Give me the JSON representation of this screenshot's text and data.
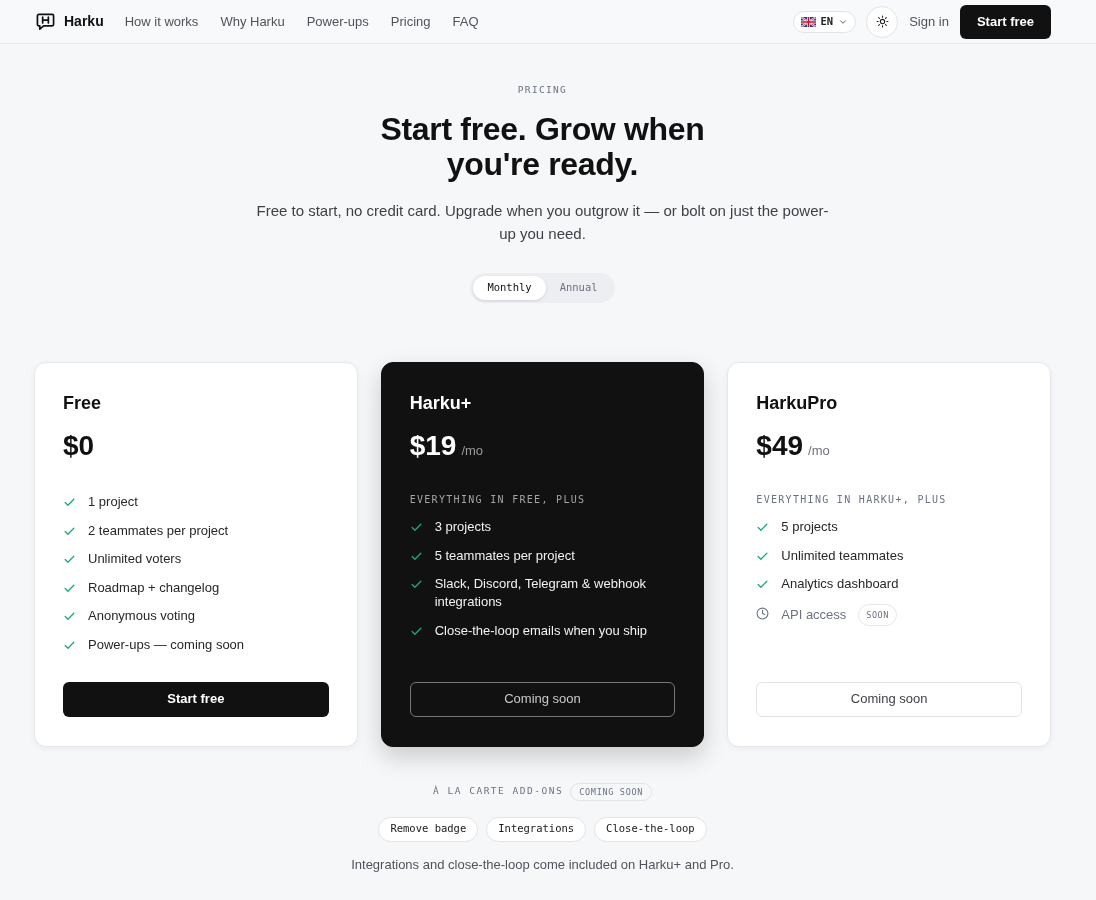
{
  "nav": {
    "brand": "Harku",
    "links": [
      "How it works",
      "Why Harku",
      "Power-ups",
      "Pricing",
      "FAQ"
    ],
    "language": "EN",
    "sign_in": "Sign in",
    "cta": "Start free"
  },
  "hero": {
    "eyebrow": "PRICING",
    "title": "Start free. Grow when you're ready.",
    "subtitle": "Free to start, no credit card. Upgrade when you outgrow it — or bolt on just the power-up you need."
  },
  "billing_toggle": [
    {
      "label": "Monthly",
      "selected": true
    },
    {
      "label": "Annual",
      "selected": false
    }
  ],
  "plans": [
    {
      "name": "Free",
      "price": "$0",
      "highlighted": false,
      "features": [
        {
          "kind": "included",
          "text": "1 project"
        },
        {
          "kind": "included",
          "text": "2 teammates per project"
        },
        {
          "kind": "included",
          "text": "Unlimited voters"
        },
        {
          "kind": "included",
          "text": "Roadmap + changelog"
        },
        {
          "kind": "included",
          "text": "Anonymous voting"
        },
        {
          "kind": "included",
          "text": "Power-ups — coming soon"
        }
      ],
      "button": {
        "kind": "primary",
        "label": "Start free"
      }
    },
    {
      "name": "Harku+",
      "price": "$19",
      "period": "/mo",
      "highlighted": true,
      "includes_label": "EVERYTHING IN FREE, PLUS",
      "features": [
        {
          "kind": "included",
          "text": "3 projects"
        },
        {
          "kind": "included",
          "text": "5 teammates per project"
        },
        {
          "kind": "included",
          "text": "Slack, Discord, Telegram & webhook integrations"
        },
        {
          "kind": "included",
          "text": "Close-the-loop emails when you ship"
        }
      ],
      "button": {
        "kind": "outline",
        "label": "Coming soon"
      }
    },
    {
      "name": "HarkuPro",
      "price": "$49",
      "period": "/mo",
      "highlighted": false,
      "includes_label": "EVERYTHING IN HARKU+, PLUS",
      "features": [
        {
          "kind": "included",
          "text": "5 projects"
        },
        {
          "kind": "included",
          "text": "Unlimited teammates"
        },
        {
          "kind": "included",
          "text": "Analytics dashboard"
        },
        {
          "kind": "soon",
          "text": "API access",
          "badge": "SOON"
        }
      ],
      "button": {
        "kind": "outline",
        "label": "Coming soon"
      }
    }
  ],
  "add_ons": {
    "title": "À LA CARTE ADD-ONS",
    "badge": "COMING SOON",
    "items": [
      "Remove badge",
      "Integrations",
      "Close-the-loop"
    ],
    "note": "Integrations and close-the-loop come included on Harku+ and Pro."
  }
}
